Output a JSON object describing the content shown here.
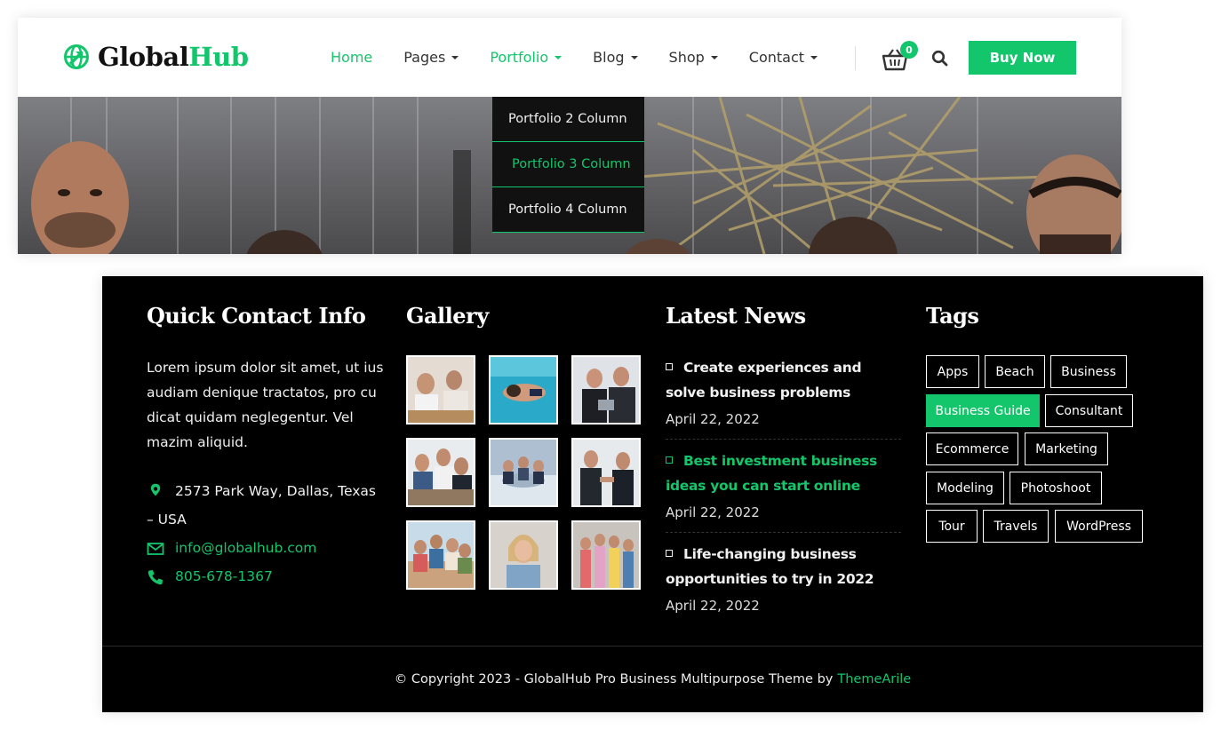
{
  "brand": {
    "name_part1": "Global",
    "name_part2": "Hub"
  },
  "nav": {
    "items": [
      {
        "label": "Home",
        "active": true,
        "has_dropdown": false
      },
      {
        "label": "Pages",
        "active": false,
        "has_dropdown": true
      },
      {
        "label": "Portfolio",
        "active": true,
        "has_dropdown": true
      },
      {
        "label": "Blog",
        "active": false,
        "has_dropdown": true
      },
      {
        "label": "Shop",
        "active": false,
        "has_dropdown": true
      },
      {
        "label": "Contact",
        "active": false,
        "has_dropdown": true
      }
    ],
    "cart_count": "0",
    "cart_icon": "basket-icon",
    "search_icon": "search-icon",
    "buy_label": "Buy Now"
  },
  "portfolio_dropdown": {
    "items": [
      {
        "label": "Portfolio 2 Column"
      },
      {
        "label": "Portfolio 3 Column"
      },
      {
        "label": "Portfolio 4 Column"
      }
    ],
    "active_index": 1
  },
  "footer": {
    "contact": {
      "title": "Quick Contact Info",
      "about": "Lorem ipsum dolor sit amet, ut ius audiam denique tractatos, pro cu dicat quidam neglegentur. Vel mazim aliquid.",
      "address": "2573 Park Way, Dallas, Texas – USA",
      "email": "info@globalhub.com",
      "phone": "805-678-1367"
    },
    "gallery": {
      "title": "Gallery"
    },
    "news": {
      "title": "Latest News",
      "items": [
        {
          "title": "Create experiences and solve business problems",
          "date": "April 22, 2022"
        },
        {
          "title": "Best investment business ideas you can start online",
          "date": "April 22, 2022"
        },
        {
          "title": "Life-changing business opportunities to try in 2022",
          "date": "April 22, 2022"
        }
      ]
    },
    "tags": {
      "title": "Tags",
      "items": [
        "Apps",
        "Beach",
        "Business",
        "Business Guide",
        "Consultant",
        "Ecommerce",
        "Marketing",
        "Modeling",
        "Photoshoot",
        "Tour",
        "Travels",
        "WordPress"
      ]
    },
    "copyright": "© Copyright 2023 - GlobalHub Pro Business Multipurpose Theme by",
    "author": "ThemeArile"
  },
  "colors": {
    "accent": "#13c56b",
    "footer_bg": "#000000",
    "dropdown_bg": "#111111"
  }
}
